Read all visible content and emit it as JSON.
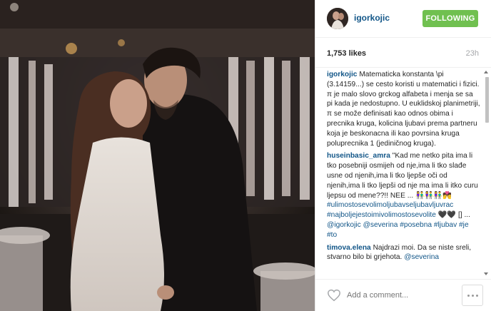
{
  "post": {
    "username": "igorkojic",
    "follow_label": "FOLLOWING",
    "likes": "1,753 likes",
    "time_ago": "23h",
    "add_comment_placeholder": "Add a comment..."
  },
  "comments": [
    {
      "user": "igorkojic",
      "text": "Matematicka konstanta \\pi (3.14159...) se cesto koristi u matematici i fizici. π je malo slovo grckog alfabeta i menja se sa pi kada je nedostupno. U euklidskoj planimetriji, π se može definisati kao odnos obima i precnika kruga, kolicina ljubavi prema partneru koja je beskonacna ili kao povrsina kruga poluprecnika 1 (jediničnog kruga)."
    },
    {
      "user": "huseinbasic_amra",
      "text": "\"Kad me netko pita ima li tko posebniji osmijeh od nje,ima li tko slađe usne od njenih,ima li tko ljepše oči od njenih,ima li tko ljepši od nje ma ima li itko curu ljepsu od mene??!! NEE ... 👫👫👫💏",
      "tags": [
        "#ulimostosevolimoljubavseljubavljuvrac",
        "#najboljejestoimivolimostosevolite",
        "🖤🖤",
        "[] ...",
        "@igorkojic",
        "@severina",
        "#posebna",
        "#ljubav",
        "#je",
        "#to"
      ]
    },
    {
      "user": "timova.elena",
      "text": "Najdrazi moi. Da se niste sreli, stvarno bilo bi grjehota.",
      "tags": [
        "@severina"
      ]
    }
  ],
  "colors": {
    "link": "#125688",
    "follow_bg": "#70c050",
    "muted": "#a5a7aa"
  },
  "icons": {
    "like": "heart-outline-icon",
    "more": "ellipsis-icon"
  }
}
